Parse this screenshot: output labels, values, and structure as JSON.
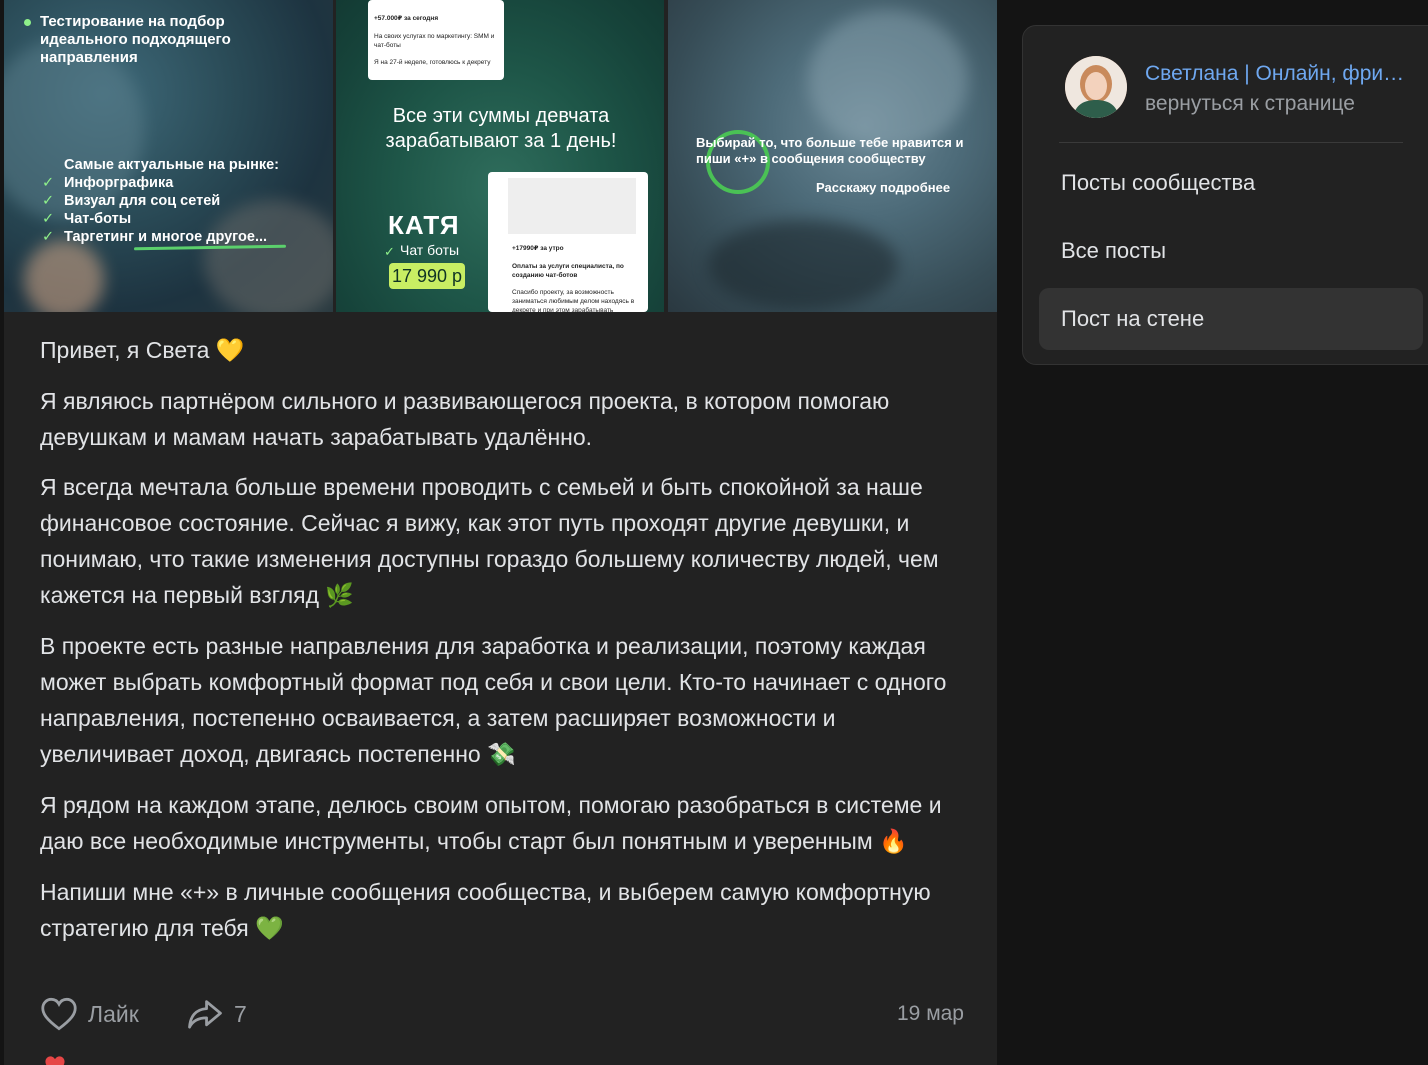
{
  "post": {
    "photos": {
      "photo1": {
        "title": "Тестирование на подбор идеального подходящего направления",
        "list_heading": "Самые актуальные на рынке:",
        "list_items": [
          "Инфорграфика",
          "Визуал для соц сетей",
          "Чат-боты",
          "Таргетинг и многое другое..."
        ]
      },
      "photo2": {
        "phone_top_line1": "+57.000₽ за сегодня",
        "phone_top_line2": "На своих услугах по маркетингу: SMM и чат-боты",
        "phone_top_line3": "Я на 27-й неделе, готовлюсь к декрету",
        "headline": "Все эти суммы девчата зарабатывают за 1 день!",
        "name": "КАТЯ",
        "role": "Чат боты",
        "amount": "17 990 р",
        "phone_bottom_line1": "+17990₽ за утро",
        "phone_bottom_line2": "Оплаты за услуги специалиста, по созданию чат-ботов",
        "phone_bottom_line3": "Спасибо проекту, за возможность заниматься любимым делом находясь в декрете и при этом зарабатывать"
      },
      "photo3": {
        "text": "Выбирай то, что больше тебе нравится и пиши «+» в сообщения сообществу",
        "more": "Расскажу подробнее"
      }
    },
    "paragraphs": [
      {
        "text": "Привет, я Света ",
        "emoji": "💛",
        "emoji_color": "#f5c518"
      },
      {
        "text": "Я являюсь партнёром сильного и развивающегося проекта, в котором помогаю девушкам и мамам начать зарабатывать удалённо.",
        "emoji": "",
        "emoji_color": ""
      },
      {
        "text": "Я всегда мечтала больше времени проводить с семьей и быть спокойной за наше финансовое состояние. Сейчас я вижу, как этот путь проходят другие девушки, и понимаю, что такие изменения доступны гораздо большему количеству людей, чем кажется на первый взгляд ",
        "emoji": "🌿",
        "emoji_color": "#7cc46a"
      },
      {
        "text": "В проекте есть разные направления для заработка и реализации, поэтому каждая может выбрать комфортный формат под себя и свои цели. Кто-то начинает с одного направления, постепенно осваивается, а затем расширяет возможности и увеличивает доход, двигаясь постепенно ",
        "emoji": "💸",
        "emoji_color": "#9ccf8a"
      },
      {
        "text": "Я рядом на каждом этапе, делюсь своим опытом, помогаю разобраться в системе и даю все необходимые инструменты, чтобы старт был понятным и уверенным ",
        "emoji": "🔥",
        "emoji_color": "#ff8a1f"
      },
      {
        "text": "Напиши мне «+» в личные сообщения сообщества, и выберем самую комфортную стратегию для тебя ",
        "emoji": "💚",
        "emoji_color": "#2fd15a"
      }
    ],
    "actions": {
      "like_label": "Лайк",
      "share_count": "7",
      "date": "19 мар"
    },
    "icons": {
      "like": "heart-icon",
      "share": "share-arrow-icon"
    }
  },
  "sidebar": {
    "community_name": "Светлана | Онлайн, фриланс",
    "back_link": "вернуться к странице",
    "nav": [
      {
        "label": "Посты сообщества",
        "active": false
      },
      {
        "label": "Все посты",
        "active": false
      },
      {
        "label": "Пост на стене",
        "active": true
      }
    ]
  },
  "colors": {
    "background": "#141414",
    "card": "#222222",
    "link": "#6fa8f0",
    "text": "#e1e3e6",
    "muted": "#9a9ea3",
    "accent_green": "#8ef08a"
  }
}
